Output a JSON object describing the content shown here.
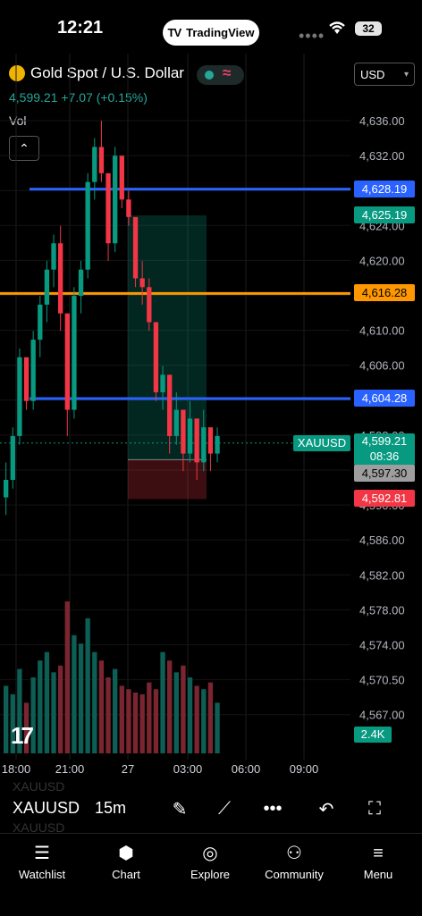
{
  "status_bar": {
    "time": "12:21",
    "app_pill": "TradingView",
    "battery": "32"
  },
  "header": {
    "symbol_title": "Gold Spot / U.S. Dollar",
    "currency": "USD",
    "price_change": "4,599.21 +7.07 (+0.15%)",
    "vol_label": "Vol"
  },
  "price_tags": {
    "upper_blue": "4,628.19",
    "target": "4,625.19",
    "orange": "4,616.28",
    "lower_blue": "4,604.28",
    "last_price": "4,599.21",
    "countdown": "08:36",
    "entry": "4,597.30",
    "stop": "4,592.81",
    "symbol_tag": "XAUUSD",
    "volume": "2.4K"
  },
  "chart_data": {
    "type": "candlestick",
    "y_ticks": [
      "4,636.00",
      "4,632.00",
      "4,628.00",
      "4,624.00",
      "4,620.00",
      "4,615.00",
      "4,610.00",
      "4,606.00",
      "4,602.00",
      "4,598.00",
      "4,594.00",
      "4,590.00",
      "4,586.00",
      "4,582.00",
      "4,578.00",
      "4,574.00",
      "4,570.50",
      "4,567.00"
    ],
    "x_ticks": [
      "18:00",
      "21:00",
      "27",
      "03:00",
      "06:00",
      "09:00"
    ],
    "horizontal_levels": [
      {
        "value": 4628.19,
        "color": "#2962ff"
      },
      {
        "value": 4616.28,
        "color": "#ff9800"
      },
      {
        "value": 4604.28,
        "color": "#2962ff"
      }
    ],
    "position": {
      "entry": 4597.3,
      "target": 4625.19,
      "stop": 4592.81
    },
    "candles": [
      [
        4593,
        4597,
        4591,
        4595
      ],
      [
        4595,
        4601,
        4594,
        4600
      ],
      [
        4600,
        4610,
        4599,
        4609
      ],
      [
        4609,
        4608,
        4603,
        4604
      ],
      [
        4604,
        4612,
        4603,
        4611
      ],
      [
        4611,
        4616,
        4609,
        4615
      ],
      [
        4615,
        4620,
        4613,
        4619
      ],
      [
        4619,
        4623,
        4617,
        4622
      ],
      [
        4622,
        4624,
        4612,
        4614
      ],
      [
        4614,
        4612,
        4600,
        4603
      ],
      [
        4603,
        4617,
        4602,
        4616
      ],
      [
        4616,
        4620,
        4614,
        4619
      ],
      [
        4619,
        4630,
        4618,
        4629
      ],
      [
        4629,
        4634,
        4627,
        4633
      ],
      [
        4633,
        4636,
        4629,
        4630
      ],
      [
        4630,
        4629,
        4620,
        4622
      ],
      [
        4622,
        4633,
        4621,
        4632
      ],
      [
        4632,
        4631,
        4626,
        4627
      ],
      [
        4627,
        4628,
        4624,
        4625
      ],
      [
        4625,
        4623,
        4617,
        4618
      ],
      [
        4618,
        4620,
        4615,
        4617
      ],
      [
        4617,
        4618,
        4612,
        4613
      ],
      [
        4613,
        4609,
        4604,
        4605
      ],
      [
        4605,
        4608,
        4603,
        4607
      ],
      [
        4607,
        4606,
        4598,
        4600
      ],
      [
        4600,
        4605,
        4599,
        4603
      ],
      [
        4603,
        4602,
        4596,
        4598
      ],
      [
        4598,
        4604,
        4597,
        4602
      ],
      [
        4602,
        4599,
        4595,
        4597
      ],
      [
        4597,
        4603,
        4596,
        4601
      ],
      [
        4601,
        4600,
        4596,
        4598
      ],
      [
        4598,
        4601,
        4597,
        4600
      ]
    ],
    "volumes": [
      40,
      35,
      50,
      30,
      45,
      55,
      60,
      48,
      52,
      90,
      70,
      65,
      80,
      60,
      55,
      45,
      50,
      40,
      38,
      36,
      35,
      42,
      38,
      60,
      55,
      48,
      52,
      45,
      40,
      38,
      42,
      30
    ]
  },
  "toolbar": {
    "symbol": "XAUUSD",
    "interval": "15m",
    "ghost": "XAUUSD"
  },
  "nav": {
    "watchlist": "Watchlist",
    "chart": "Chart",
    "explore": "Explore",
    "community": "Community",
    "menu": "Menu"
  },
  "colors": {
    "up": "#089981",
    "down": "#f23645",
    "blue_level": "#2962ff",
    "orange_level": "#ff9800"
  }
}
